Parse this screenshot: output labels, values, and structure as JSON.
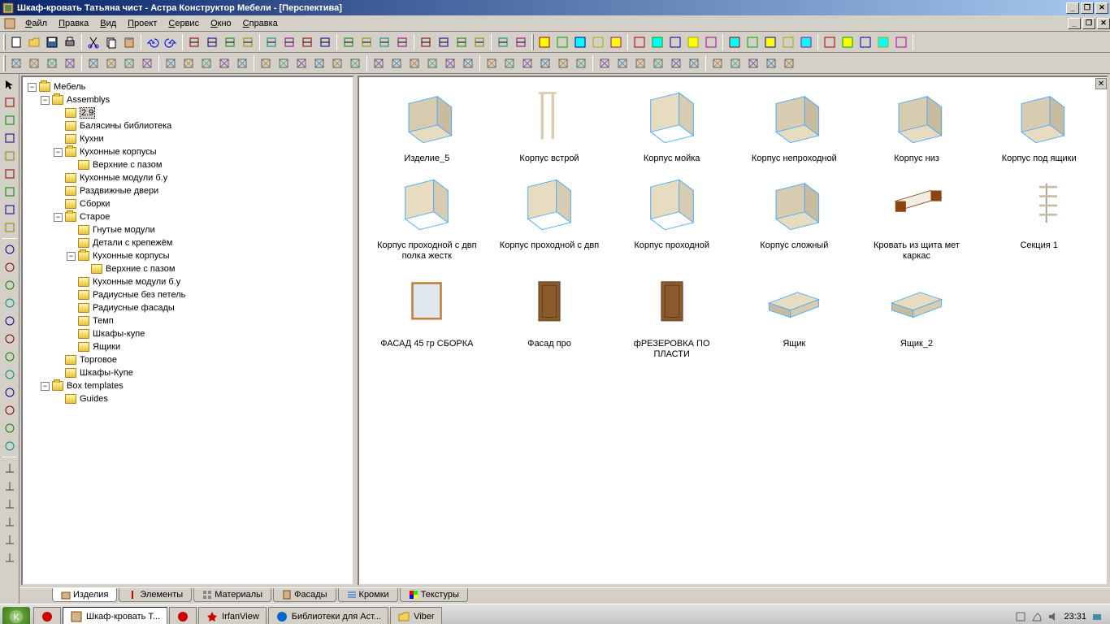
{
  "title": "Шкаф-кровать Татьяна чист - Астра Конструктор Мебели - [Перспектива]",
  "menu": [
    "Файл",
    "Правка",
    "Вид",
    "Проект",
    "Сервис",
    "Окно",
    "Справка"
  ],
  "tree": {
    "root": "Мебель",
    "assemblys": "Assemblys",
    "n29": "2.9",
    "balyasiny": "Балясины библиотека",
    "kuhni": "Кухни",
    "kuhkorp": "Кухонные корпусы",
    "verhpaz": "Верхние с пазом",
    "kuhmod": "Кухонные модули б.у",
    "razdv": "Раздвижные двери",
    "sborki": "Сборки",
    "staroe": "Старое",
    "gnut": "Гнутые модули",
    "detkrep": "Детали с крепежём",
    "kuhkorp2": "Кухонные корпусы",
    "verhpaz2": "Верхние с пазом",
    "kuhmod2": "Кухонные модули б.у",
    "radbez": "Радиусные без петель",
    "radfas": "Радиусные фасады",
    "temp": "Темп",
    "shkupe": "Шкафы-купе",
    "yash": "Ящики",
    "torg": "Торговое",
    "shkupe2": "Шкафы-Купе",
    "boxtpl": "Box templates",
    "guides": "Guides"
  },
  "thumbs": [
    {
      "label": "Изделие_5"
    },
    {
      "label": "Корпус встрой"
    },
    {
      "label": "Корпус мойка"
    },
    {
      "label": "Корпус непроходной"
    },
    {
      "label": "Корпус низ"
    },
    {
      "label": "Корпус под ящики"
    },
    {
      "label": "Корпус проходной с двп полка жестк"
    },
    {
      "label": "Корпус проходной с двп"
    },
    {
      "label": "Корпус проходной"
    },
    {
      "label": "Корпус сложный"
    },
    {
      "label": "Кровать из щита мет каркас"
    },
    {
      "label": "Секция 1"
    },
    {
      "label": "ФАСАД 45 гр СБОРКА"
    },
    {
      "label": "Фасад про"
    },
    {
      "label": "фРЕЗЕРОВКА ПО ПЛАСТИ"
    },
    {
      "label": "Ящик"
    },
    {
      "label": "Ящик_2"
    }
  ],
  "tabs": {
    "izdeliya": "Изделия",
    "elementy": "Элементы",
    "materialy": "Материалы",
    "fasady": "Фасады",
    "kromki": "Кромки",
    "tekstury": "Текстуры"
  },
  "taskbar": {
    "t1": "Шкаф-кровать Т...",
    "t2": "IrfanView",
    "t3": "Библиотеки для Аст...",
    "t4": "Viber"
  },
  "clock": "23:31"
}
